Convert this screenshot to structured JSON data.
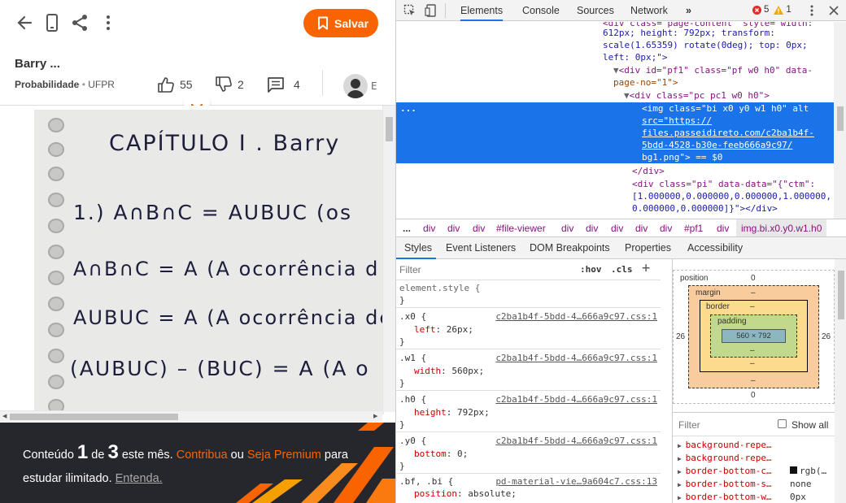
{
  "topbar": {
    "save_label": "Salvar",
    "accent": "#fa6400"
  },
  "doc": {
    "title": "Barry ...",
    "subject": "Probabilidade",
    "institution": "UFPR",
    "likes": "55",
    "dislikes": "2",
    "comments": "4",
    "avatar_cut": "E"
  },
  "page_lines": {
    "l1": "CAPÍTULO I . Barry",
    "l2": "1.)  A∩B∩C = AUBUC  (os",
    "l3": "A∩B∩C = A   (A ocorrência d",
    "l4": "AUBUC = A  (A ocorrência de",
    "l5": "(AUBUC) – (BUC) = A   (A o"
  },
  "banner": {
    "text1": "Conteúdo ",
    "count": "1",
    "text2": " de ",
    "limit": "3",
    "text3": " este mês. ",
    "link1": "Contribua",
    "text4": " ou ",
    "link2": "Seja Premium",
    "text5": " para estudar ilimitado. ",
    "link3": "Entenda."
  },
  "devtools": {
    "tabs": [
      "Elements",
      "Console",
      "Sources",
      "Network"
    ],
    "more": "»",
    "errors": "5",
    "warnings": "1",
    "dom": {
      "line0": "<div class=\"page-content\" style=\"width:",
      "line1": "612px; height: 792px; transform:",
      "line2": "scale(1.65359) rotate(0deg); top: 0px;",
      "line3": "left: 0px;\">",
      "line4_tag": "<div id=\"pf1\" class=\"pf w0 h0\" data-",
      "line5": "page-no=\"1\">",
      "line6": "<div class=\"pc pc1 w0 h0\">",
      "sel1": "<img class=\"bi x0 y0 w1 h0\" alt",
      "sel2": "src=\"https://",
      "sel3": "files.passeidireto.com/c2ba1b4f-",
      "sel4": "5bdd-4528-b30e-feeb666a9c97/",
      "sel5": "bg1.png\"> == $0",
      "line7": "</div>",
      "line8": "<div class=\"pi\" data-data=\"{\"ctm\":",
      "line9": "[1.000000,0.000000,0.000000,1.000000,",
      "line10": "0.000000,0.000000]}\"></div>",
      "ellipsis": "..."
    },
    "crumbs": [
      "...",
      "div",
      "div",
      "div",
      "#file-viewer",
      "div",
      "div",
      "div",
      "div",
      "div",
      "#pf1",
      "div",
      "img.bi.x0.y0.w1.h0"
    ],
    "style_tabs": [
      "Styles",
      "Event Listeners",
      "DOM Breakpoints",
      "Properties",
      "Accessibility"
    ],
    "filter_placeholder": "Filter",
    "hov": ":hov",
    "cls": ".cls",
    "rules": {
      "element_style": "element.style {",
      "close": "}",
      "x0_sel": ".x0 {",
      "x0_prop": "left",
      "x0_val": "26px;",
      "x0_src": "c2ba1b4f-5bdd-4…666a9c97.css:1",
      "w1_sel": ".w1 {",
      "w1_prop": "width",
      "w1_val": "560px;",
      "w1_src": "c2ba1b4f-5bdd-4…666a9c97.css:1",
      "h0_sel": ".h0 {",
      "h0_prop": "height",
      "h0_val": "792px;",
      "h0_src": "c2ba1b4f-5bdd-4…666a9c97.css:1",
      "y0_sel": ".y0 {",
      "y0_prop": "bottom",
      "y0_val": "0;",
      "y0_src": "c2ba1b4f-5bdd-4…666a9c97.css:1",
      "bf_sel": ".bf, .bi {",
      "bf_prop": "position",
      "bf_val": "absolute;",
      "bf_src": "pd-material-vie…9a604c7.css:13"
    },
    "boxmodel": {
      "position_label": "position",
      "position_val": "0",
      "margin_label": "margin",
      "margin_val": "–",
      "border_label": "border",
      "border_val": "–",
      "padding_label": "padding",
      "padding_val": "–",
      "content": "560 × 792",
      "left": "26",
      "right": "26",
      "bottom": "0",
      "dash": "–"
    },
    "computed_filter": "Filter",
    "show_all": "Show all",
    "computed": [
      {
        "name": "background-repe…",
        "value": ""
      },
      {
        "name": "background-repe…",
        "value": ""
      },
      {
        "name": "border-bottom-c…",
        "value": "rgb(…"
      },
      {
        "name": "border-bottom-s…",
        "value": "none"
      },
      {
        "name": "border-bottom-w…",
        "value": "0px"
      }
    ]
  }
}
